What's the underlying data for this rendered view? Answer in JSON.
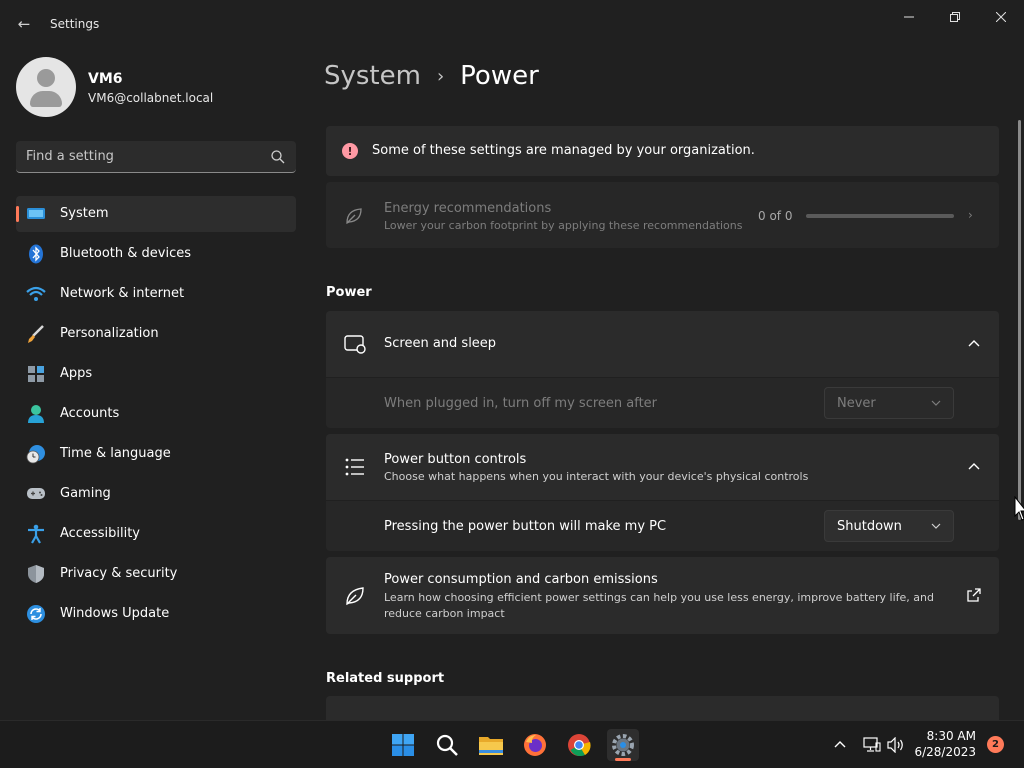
{
  "window": {
    "title": "Settings",
    "controls": [
      "minimize",
      "maximize",
      "close"
    ]
  },
  "profile": {
    "name": "VM6",
    "email": "VM6@collabnet.local"
  },
  "search": {
    "placeholder": "Find a setting",
    "icon": "search-icon"
  },
  "sidebar": {
    "items": [
      {
        "label": "System",
        "icon": "system-icon",
        "active": true
      },
      {
        "label": "Bluetooth & devices",
        "icon": "bluetooth-icon"
      },
      {
        "label": "Network & internet",
        "icon": "wifi-icon"
      },
      {
        "label": "Personalization",
        "icon": "brush-icon"
      },
      {
        "label": "Apps",
        "icon": "apps-icon"
      },
      {
        "label": "Accounts",
        "icon": "accounts-icon"
      },
      {
        "label": "Time & language",
        "icon": "clock-globe-icon"
      },
      {
        "label": "Gaming",
        "icon": "gamepad-icon"
      },
      {
        "label": "Accessibility",
        "icon": "accessibility-icon"
      },
      {
        "label": "Privacy & security",
        "icon": "shield-icon"
      },
      {
        "label": "Windows Update",
        "icon": "update-icon"
      }
    ]
  },
  "breadcrumb": {
    "parent": "System",
    "separator": "›",
    "current": "Power"
  },
  "org_banner": {
    "text": "Some of these settings are managed by your organization.",
    "icon": "info-icon",
    "icon_glyph": "!"
  },
  "energy": {
    "title": "Energy recommendations",
    "subtitle": "Lower your carbon footprint by applying these recommendations",
    "count": "0 of 0",
    "progress": 0
  },
  "sections": {
    "power": "Power",
    "related": "Related support"
  },
  "screen_sleep": {
    "title": "Screen and sleep",
    "row_label": "When plugged in, turn off my screen after",
    "value": "Never"
  },
  "power_button": {
    "title": "Power button controls",
    "subtitle": "Choose what happens when you interact with your device's physical controls",
    "row_label": "Pressing the power button will make my PC",
    "value": "Shutdown"
  },
  "power_consumption": {
    "title": "Power consumption and carbon emissions",
    "subtitle": "Learn how choosing efficient power settings can help you use less energy, improve battery life, and reduce carbon impact"
  },
  "taskbar": {
    "apps": [
      "start-icon",
      "search-icon",
      "file-explorer-icon",
      "firefox-icon",
      "chrome-icon",
      "settings-icon"
    ],
    "time": "8:30 AM",
    "date": "6/28/2023",
    "notifications": "2"
  },
  "colors": {
    "accent": "#ff7a59",
    "background": "#202020",
    "card": "#2b2b2b"
  }
}
